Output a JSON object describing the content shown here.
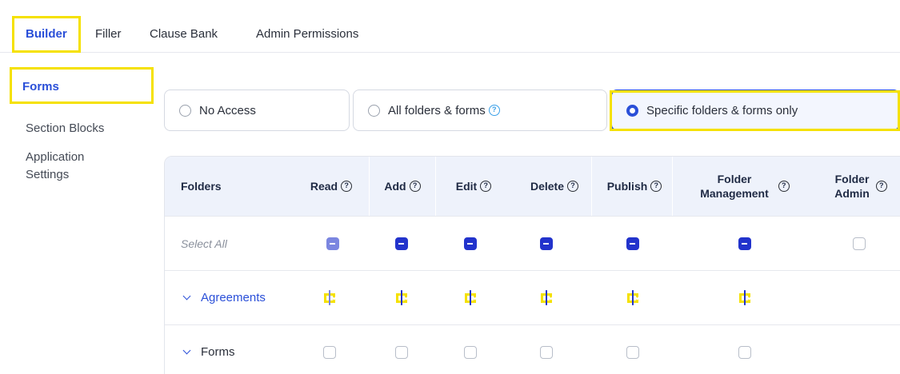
{
  "topnav": {
    "tabs": [
      {
        "label": "Builder",
        "active": true
      },
      {
        "label": "Filler",
        "active": false
      },
      {
        "label": "Clause Bank",
        "active": false
      },
      {
        "label": "Admin Permissions",
        "active": false
      }
    ]
  },
  "sidebar": {
    "items": [
      {
        "label": "Forms",
        "active": true
      },
      {
        "label": "Section Blocks",
        "active": false
      },
      {
        "label": "Application",
        "active": false
      },
      {
        "label": "Settings",
        "active": false
      }
    ]
  },
  "access": {
    "options": [
      {
        "label": "No Access",
        "selected": false
      },
      {
        "label": "All folders & forms",
        "selected": false,
        "help_icon": "question-circle-icon"
      },
      {
        "label": "Specific folders & forms only",
        "selected": true
      }
    ]
  },
  "table": {
    "columns": [
      {
        "label": "Folders"
      },
      {
        "label": "Read"
      },
      {
        "label": "Add"
      },
      {
        "label": "Edit"
      },
      {
        "label": "Delete"
      },
      {
        "label": "Publish"
      },
      {
        "label_line1": "Folder",
        "label_line2": "Management"
      },
      {
        "label_line1": "Folder",
        "label_line2": "Admin"
      }
    ],
    "help_glyph": "?",
    "rows": [
      {
        "label": "Select All",
        "states": [
          "indeterminate-light",
          "indeterminate",
          "indeterminate",
          "indeterminate",
          "indeterminate",
          "indeterminate",
          "unchecked"
        ]
      },
      {
        "label": "Agreements",
        "expand_icon": "chevron-down-icon",
        "states": [
          "checked-light",
          "checked",
          "checked",
          "checked",
          "checked",
          "checked"
        ]
      },
      {
        "label": "Forms",
        "expand_icon": "chevron-down-icon",
        "states": [
          "unchecked",
          "unchecked",
          "unchecked",
          "unchecked",
          "unchecked",
          "unchecked"
        ]
      }
    ]
  },
  "colors": {
    "accent": "#2a4fd8",
    "checkbox_fill": "#2233cc",
    "highlight": "#f5e100",
    "header_bg": "#eef2fb"
  }
}
